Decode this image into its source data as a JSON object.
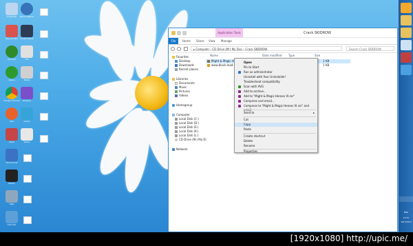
{
  "desktop": {
    "icon_labels": [
      "Computer",
      "Drive Cleaner",
      "Recycle Bin",
      "Control Panel",
      "uTorrent",
      "File",
      "Opera",
      "Nokia",
      "Google Chrome",
      "Winamp",
      "AVG",
      "Game",
      "Paint",
      "Documents",
      "Steam",
      "Help",
      "Unlocker",
      "Setup"
    ]
  },
  "taskbar": {
    "lang": "ENG",
    "time": "14:31",
    "date": "16/7/2013"
  },
  "explorer": {
    "title": "Crack SKIDROW",
    "context_tab": "Application Tools",
    "ribbon_tabs": [
      "File",
      "Home",
      "Share",
      "View",
      "Manage"
    ],
    "address": "▸ Computer  ›  CD Drive (M:) My Disc  ›  Crack SKIDROW",
    "search_placeholder": "Search Crack SKIDROW",
    "columns": [
      "Name",
      "Date modified",
      "Type",
      "Size"
    ],
    "files": [
      {
        "name": "Might & Magic Heroes",
        "size": "1 KB"
      },
      {
        "name": "www.black-load-1.mo",
        "size": "1 KB"
      }
    ],
    "nav": {
      "favorites": "Favorites",
      "desktop": "Desktop",
      "downloads": "Downloads",
      "recent": "Recent places",
      "libraries": "Libraries",
      "documents": "Documents",
      "music": "Music",
      "pictures": "Pictures",
      "videos": "Videos",
      "homegroup": "Homegroup",
      "computer": "Computer",
      "disk_c": "Local Disk (C:)",
      "disk_d": "Local Disk (D:)",
      "disk_e": "Local Disk (E:)",
      "disk_k": "Local Disk (K:)",
      "disk_l": "Local Disk (L:)",
      "cd_drive": "CD Drive (M:) My Di",
      "network": "Network"
    }
  },
  "context_menu": {
    "items": [
      "Open",
      "Pin to Start",
      "Run as administrator",
      "Uninstall with Your Uninstaller!",
      "Troubleshoot compatibility",
      "Scan with AVG",
      "Add to archive...",
      "Add to \"Might & Magic Heroes VI.rar\"",
      "Compress and email...",
      "Compress to \"Might & Magic Heroes VI.rar\" and email",
      "Send to",
      "Cut",
      "Copy",
      "Paste",
      "Create shortcut",
      "Delete",
      "Rename",
      "Properties"
    ],
    "icon_colors": {
      "shield": "#2d6fd0",
      "avg": "#3a8e2f",
      "rar": "#8e2a8e"
    }
  },
  "watermark": "[1920x1080] http://upic.me/"
}
